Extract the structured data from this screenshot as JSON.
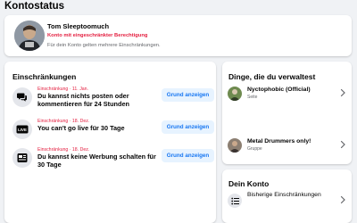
{
  "page": {
    "title": "Kontostatus"
  },
  "status": {
    "name": "Tom Sleeptoomuch",
    "restriction": "Konto mit eingeschränkter Berechtigung",
    "description": "Für dein Konto gelten mehrere Einschränkungen."
  },
  "restrictions": {
    "title": "Einschränkungen",
    "button_label": "Grund anzeigen",
    "items": [
      {
        "date": "Einschränkung · 11. Jan.",
        "text": "Du kannst nichts posten oder kommentieren für 24 Stunden",
        "icon": "speech-bubbles-icon"
      },
      {
        "date": "Einschränkung · 18. Dez.",
        "text": "You can't go live für 30 Tage",
        "icon": "live-icon"
      },
      {
        "date": "Einschränkung · 18. Dez.",
        "text": "Du kannst keine Werbung schalten für 30 Tage",
        "icon": "ad-icon"
      }
    ]
  },
  "manage": {
    "title": "Dinge, die du verwaltest",
    "items": [
      {
        "name": "Nyctophobic (Official)",
        "type": "Seite"
      },
      {
        "name": "Metal Drummers only!",
        "type": "Gruppe"
      }
    ]
  },
  "account": {
    "title": "Dein Konto",
    "item_label": "Bisherige Einschränkungen"
  },
  "colors": {
    "accent": "#1877f2",
    "warning": "#e41e3f",
    "button_bg": "#e7f3ff",
    "background": "#f0f2f5"
  }
}
